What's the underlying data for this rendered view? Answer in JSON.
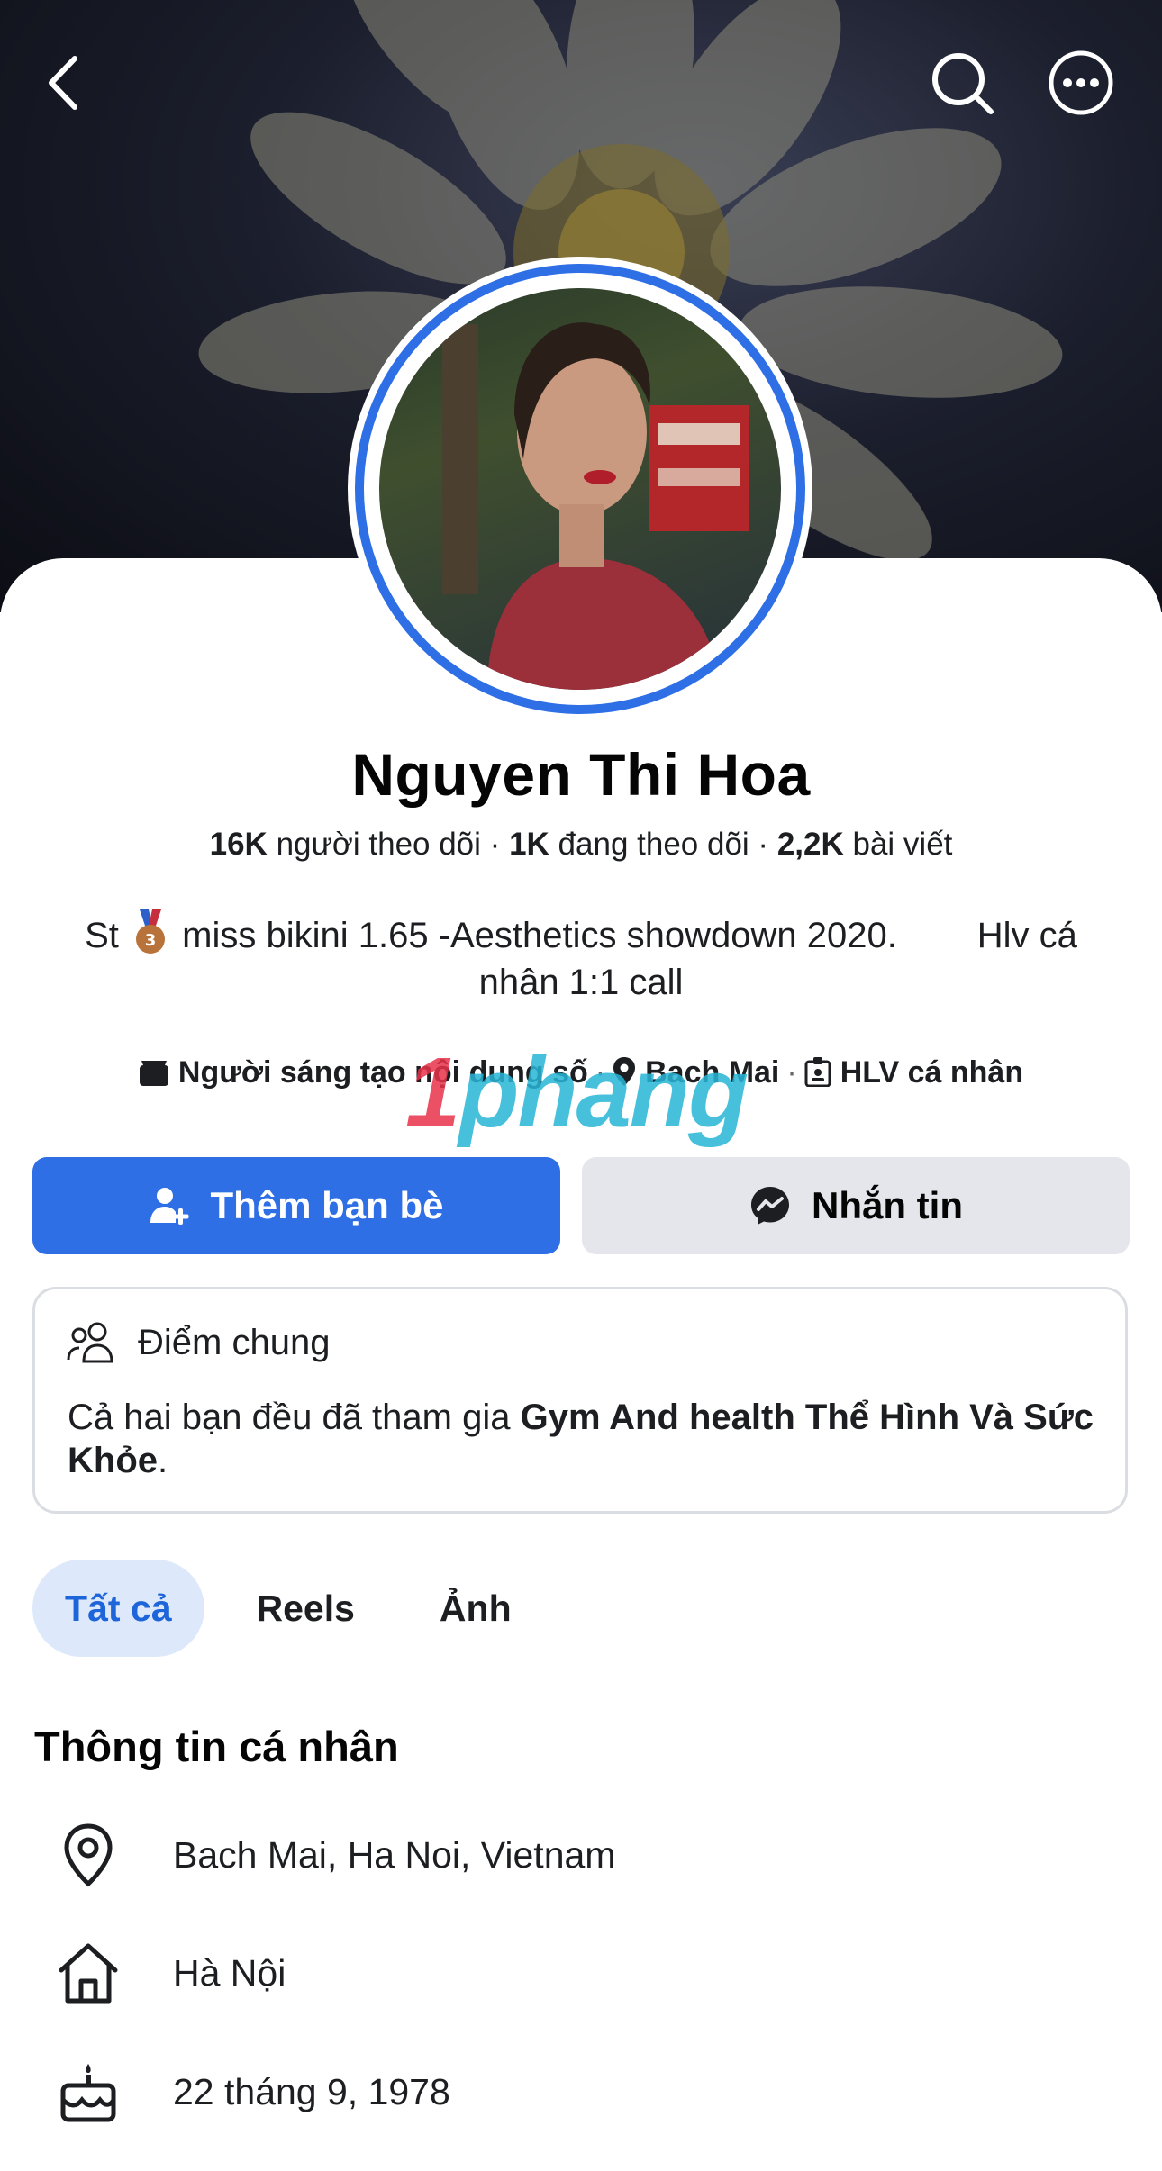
{
  "header": {
    "back_icon": "chevron-left-icon",
    "search_icon": "search-icon",
    "more_icon": "more-horizontal-icon"
  },
  "profile": {
    "name": "Nguyen Thi Hoa",
    "stats": {
      "followers_count": "16K",
      "followers_label": "người theo dõi",
      "following_count": "1K",
      "following_label": "đang theo dõi",
      "posts_count": "2,2K",
      "posts_label": "bài viết"
    },
    "bio_line1_pre": "St",
    "bio_line1_post": "miss bikini 1.65 -Aesthetics showdown 2020.        Hlv cá",
    "bio_line2": "nhân 1:1 call",
    "meta": {
      "category": "Người sáng tạo nội dung số",
      "location": "Bach Mai",
      "job": "HLV cá nhân"
    }
  },
  "actions": {
    "add_friend": "Thêm bạn bè",
    "message": "Nhắn tin"
  },
  "mutual": {
    "title": "Điểm chung",
    "text_pre": "Cả hai bạn đều đã tham gia ",
    "group": "Gym And health Thể Hình Và Sức Khỏe",
    "text_post": "."
  },
  "tabs": [
    {
      "label": "Tất cả",
      "active": true
    },
    {
      "label": "Reels",
      "active": false
    },
    {
      "label": "Ảnh",
      "active": false
    }
  ],
  "info": {
    "title": "Thông tin cá nhân",
    "location": "Bach Mai, Ha Noi, Vietnam",
    "hometown": "Hà Nội",
    "birthday": "22 tháng 9, 1978"
  },
  "watermark": {
    "part1": "1",
    "part2": "phang"
  },
  "colors": {
    "primary": "#2e6fe6",
    "secondary_button": "#e4e6eb",
    "active_tab_bg": "#dde9fb"
  }
}
